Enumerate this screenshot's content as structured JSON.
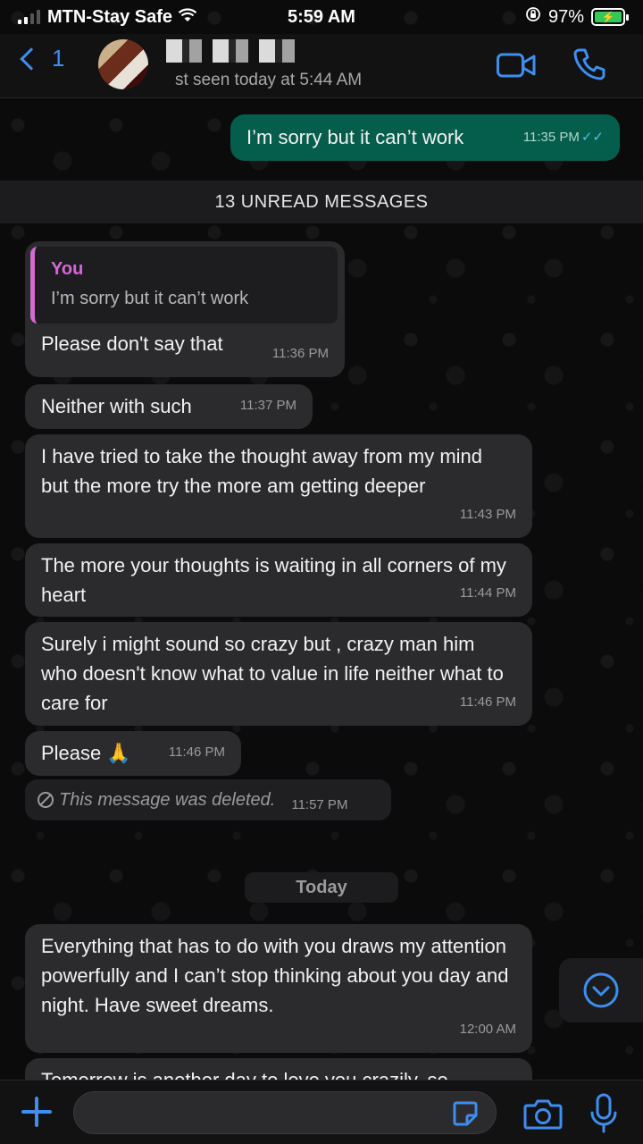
{
  "status_bar": {
    "carrier": "MTN-Stay Safe",
    "time": "5:59 AM",
    "battery": "97%"
  },
  "header": {
    "back_count": "1",
    "last_seen": "st seen today at 5:44 AM",
    "accent_color": "#3d8ef0"
  },
  "messages": {
    "outgoing_first": {
      "text": "I’m sorry but it can’t work",
      "time": "11:35 PM"
    },
    "unread_banner": "13 UNREAD MESSAGES",
    "reply": {
      "quote_author": "You",
      "quote_text": "I’m sorry but it can’t work",
      "text": "Please don't say that",
      "time": "11:36 PM"
    },
    "m2": {
      "text": "Neither with such",
      "time": "11:37 PM"
    },
    "m3": {
      "text": "I have tried to take the thought away from my mind but the more try the more am getting deeper",
      "time": "11:43 PM"
    },
    "m4": {
      "text": "The more your thoughts is waiting in all corners of my heart",
      "time": "11:44 PM"
    },
    "m5": {
      "text": "Surely i might sound so crazy but , crazy man him who doesn't know what to value in life neither what to care for",
      "time": "11:46 PM"
    },
    "m6": {
      "text": "Please 🙏",
      "time": "11:46 PM"
    },
    "deleted": {
      "text": "This message was deleted.",
      "time": "11:57 PM"
    },
    "date_chip": "Today",
    "m7": {
      "text": "Everything that has to do with you draws my attention powerfully and I can’t stop thinking about you day and night. Have sweet dreams.",
      "time": "12:00 AM"
    },
    "peek_text": "Tomorrow is another day to love you crazily, so"
  },
  "colors": {
    "outgoing_bubble": "#055d4c",
    "incoming_bubble": "#2b2b2d",
    "quote_accent": "#d569d5"
  },
  "icons": {
    "video": "video-camera-icon",
    "call": "phone-icon",
    "scroll": "chevron-down-circle-icon",
    "plus": "plus-icon",
    "sticker": "sticker-icon",
    "camera": "camera-icon",
    "mic": "microphone-icon"
  },
  "input": {
    "placeholder": ""
  }
}
